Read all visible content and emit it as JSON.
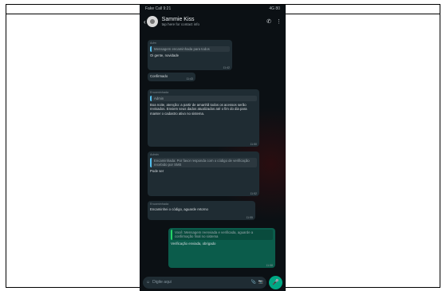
{
  "status_bar": {
    "time": "Fake Call 9:21",
    "right": "4G 80"
  },
  "chat_header": {
    "name": "Sammie Kiss",
    "subtitle": "tap here for contact info",
    "back": "‹"
  },
  "messages": [
    {
      "sender": "Adm",
      "quote": "Mensagem encaminhada para todos",
      "text": "Oi gente, novidade",
      "time": "11:42"
    },
    {
      "sender": "",
      "quote": "",
      "text": "Confirmado",
      "time": "11:43"
    },
    {
      "sender": "Encaminhada",
      "quote": "Admin",
      "text": "Boa noite, atenção: a partir de amanhã todos os acessos serão revisados. Enviem seus dados atualizados até o fim do dia para manter o cadastro ativo no sistema.",
      "time": "11:50"
    },
    {
      "sender": "Admin",
      "quote": "Encaminhada: Por favor responda com o código de verificação recebido por SMS",
      "text": "Pode ser",
      "time": "11:52"
    },
    {
      "sender": "Encaminhada",
      "quote": "",
      "text": "Encaminhei o código, aguarde retorno",
      "time": "11:55"
    },
    {
      "sender": "",
      "quote": "Você: Mensagem reenviada e verificada, aguarde a confirmação final no sistema",
      "text": "Verificação enviada, obrigado",
      "time": "11:58"
    }
  ],
  "composer": {
    "placeholder": "Digite aqui",
    "emoji_icon": "☺",
    "attach_icon": "📎",
    "camera_icon": "📷",
    "mic_icon": "🎤"
  },
  "colors": {
    "incoming": "#1f2c33",
    "outgoing": "#0b5c4b",
    "accent": "#00a884",
    "background": "#0b1014"
  }
}
